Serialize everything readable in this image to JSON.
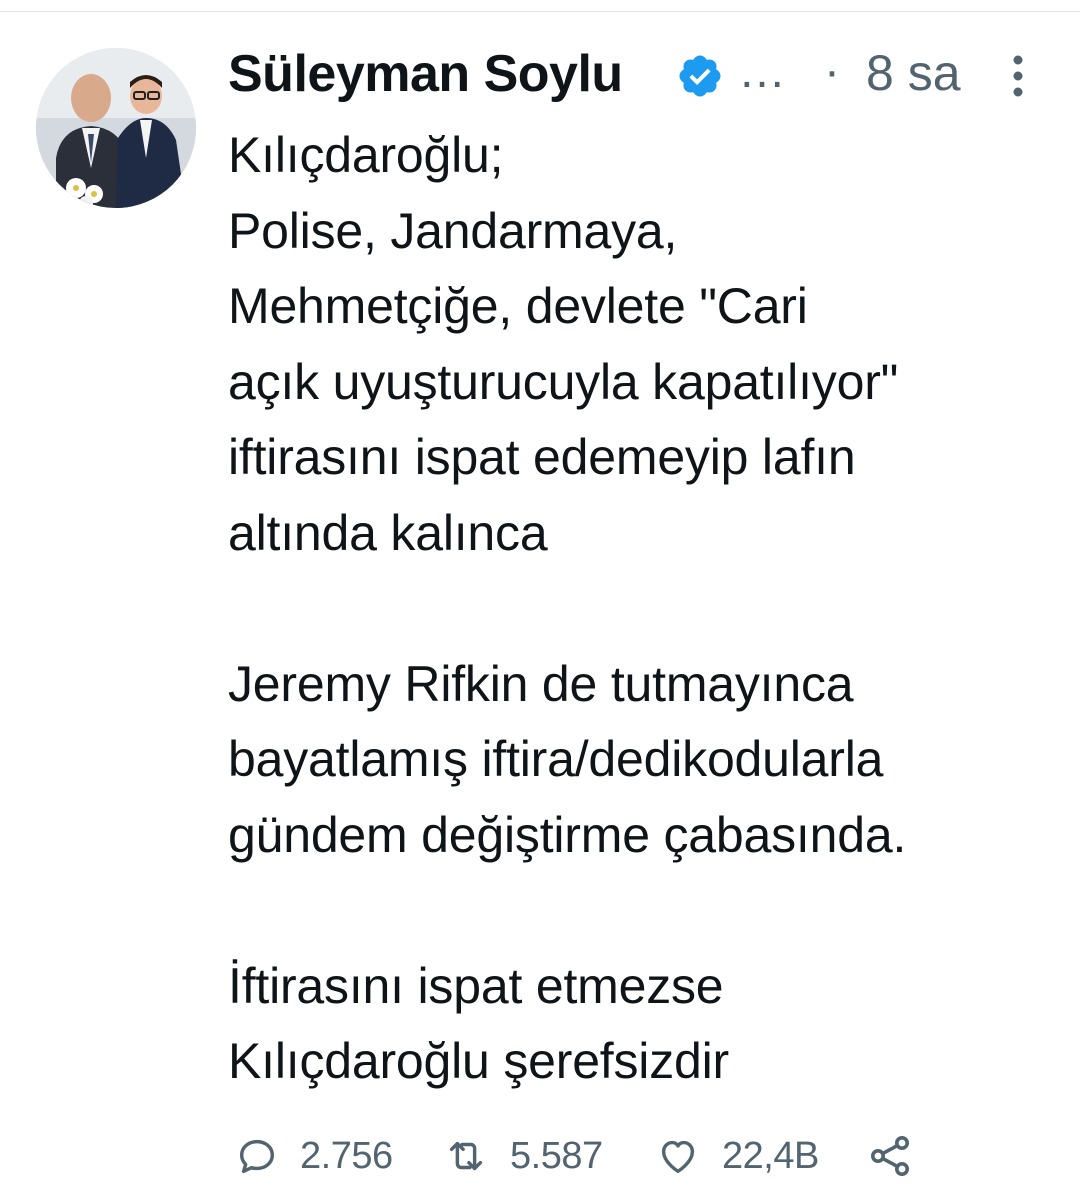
{
  "tweet": {
    "author": {
      "display_name": "Süleyman Soylu",
      "verified": true,
      "overflow": "…",
      "separator": "·",
      "timestamp": "8 sa"
    },
    "lines": [
      "Kılıçdaroğlu;",
      "Polise, Jandarmaya,",
      "Mehmetçiğe, devlete \"Cari",
      "açık uyuşturucuyla kapatılıyor\"",
      "iftirasını ispat edemeyip lafın",
      "altında kalınca",
      "",
      "Jeremy Rifkin de tutmayınca",
      "bayatlamış iftira/dedikodularla",
      "gündem değiştirme çabasında.",
      "",
      "İftirasını ispat etmezse",
      "Kılıçdaroğlu şerefsizdir"
    ],
    "stats": {
      "replies": "2.756",
      "retweets": "5.587",
      "likes": "22,4B"
    }
  },
  "colors": {
    "verified_badge": "#1d9bf0",
    "secondary_text": "#536471",
    "primary_text": "#0f1419"
  },
  "icons": [
    "verified-badge-icon",
    "more-vertical-icon",
    "reply-icon",
    "retweet-icon",
    "like-icon",
    "share-icon"
  ]
}
